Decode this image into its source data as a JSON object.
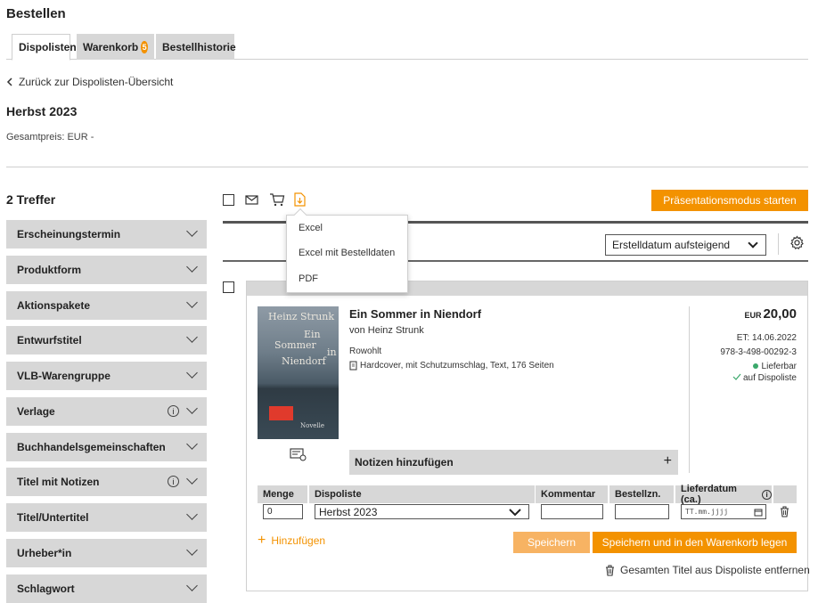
{
  "header": {
    "title": "Bestellen"
  },
  "tabs": [
    {
      "label": "Dispolisten"
    },
    {
      "label": "Warenkorb",
      "badge": "5"
    },
    {
      "label": "Bestellhistorie"
    }
  ],
  "back_link": "Zurück zur Dispolisten-Übersicht",
  "list": {
    "title": "Herbst 2023",
    "total": "Gesamtpreis: EUR -"
  },
  "results": {
    "count": "2 Treffer"
  },
  "filters": [
    {
      "label": "Erscheinungstermin",
      "info": false
    },
    {
      "label": "Produktform",
      "info": false
    },
    {
      "label": "Aktionspakete",
      "info": false
    },
    {
      "label": "Entwurfstitel",
      "info": false
    },
    {
      "label": "VLB-Warengruppe",
      "info": false
    },
    {
      "label": "Verlage",
      "info": true
    },
    {
      "label": "Buchhandelsgemeinschaften",
      "info": false
    },
    {
      "label": "Titel mit Notizen",
      "info": true
    },
    {
      "label": "Titel/Untertitel",
      "info": false
    },
    {
      "label": "Urheber*in",
      "info": false
    },
    {
      "label": "Schlagwort",
      "info": false
    }
  ],
  "toolbar": {
    "presentation_button": "Präsentationsmodus starten",
    "sort_value": "Erstelldatum aufsteigend"
  },
  "export_menu": [
    "Excel",
    "Excel mit Bestelldaten",
    "PDF"
  ],
  "book": {
    "title": "Ein Sommer in Niendorf",
    "author": "von Heinz Strunk",
    "publisher": "Rowohlt",
    "format": "Hardcover, mit Schutzumschlag, Text, 176 Seiten",
    "cover_author": "Heinz Strunk",
    "cover_title": [
      "Ein",
      "Sommer",
      "in",
      "Niendorf"
    ],
    "cover_genre": "Novelle",
    "currency": "EUR",
    "price": "20,00",
    "release": "ET: 14.06.2022",
    "isbn": "978-3-498-00292-3",
    "availability": "Lieferbar",
    "on_list": "auf Dispoliste",
    "notes_label": "Notizen hinzufügen"
  },
  "order_table": {
    "headers": [
      "Menge",
      "Dispoliste",
      "Kommentar",
      "Bestellzn.",
      "Lieferdatum (ca.)"
    ],
    "quantity": "0",
    "dispoliste": "Herbst 2023",
    "comment": "",
    "order_sign": "",
    "date_placeholder": "TT.mm.jjjj"
  },
  "actions": {
    "add": "Hinzufügen",
    "save": "Speichern",
    "save_cart": "Speichern und in den Warenkorb legen",
    "remove": "Gesamten Titel aus Dispoliste entfernen"
  },
  "colors": {
    "accent": "#f39200",
    "accent_light": "#f7b363",
    "filter_bg": "#d7d7d7",
    "available": "#3aa86b"
  }
}
